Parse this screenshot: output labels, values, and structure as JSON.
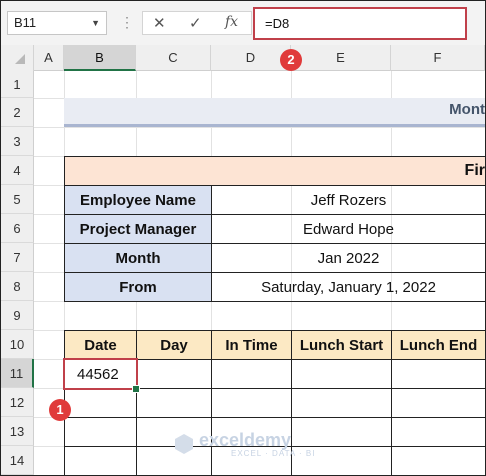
{
  "name_box": {
    "value": "B11"
  },
  "formula_bar": {
    "cancel": "✕",
    "enter": "✓",
    "fx": "fx",
    "formula": "=D8"
  },
  "columns": [
    "A",
    "B",
    "C",
    "D",
    "E",
    "F"
  ],
  "rows": [
    "1",
    "2",
    "3",
    "4",
    "5",
    "6",
    "7",
    "8",
    "9",
    "10",
    "11",
    "12",
    "13",
    "14"
  ],
  "sheet": {
    "banner_text": "Mont",
    "section_title": "Fir",
    "info": [
      {
        "label": "Employee Name",
        "value": "Jeff Rozers"
      },
      {
        "label": "Project Manager",
        "value": "Edward Hope"
      },
      {
        "label": "Month",
        "value": "Jan 2022"
      },
      {
        "label": "From",
        "value": "Saturday, January 1, 2022"
      }
    ],
    "table_headers": [
      "Date",
      "Day",
      "In Time",
      "Lunch Start",
      "Lunch End"
    ],
    "active_cell_value": "44562"
  },
  "badges": {
    "one": "1",
    "two": "2"
  },
  "watermark": {
    "name": "exceldemy",
    "tagline": "EXCEL · DATA · BI"
  },
  "colors": {
    "accent_red": "#c0404a",
    "selection_green": "#217346",
    "label_blue": "#d9e1f2",
    "header_yellow": "#fce9c4",
    "peach": "#fde4d4"
  }
}
